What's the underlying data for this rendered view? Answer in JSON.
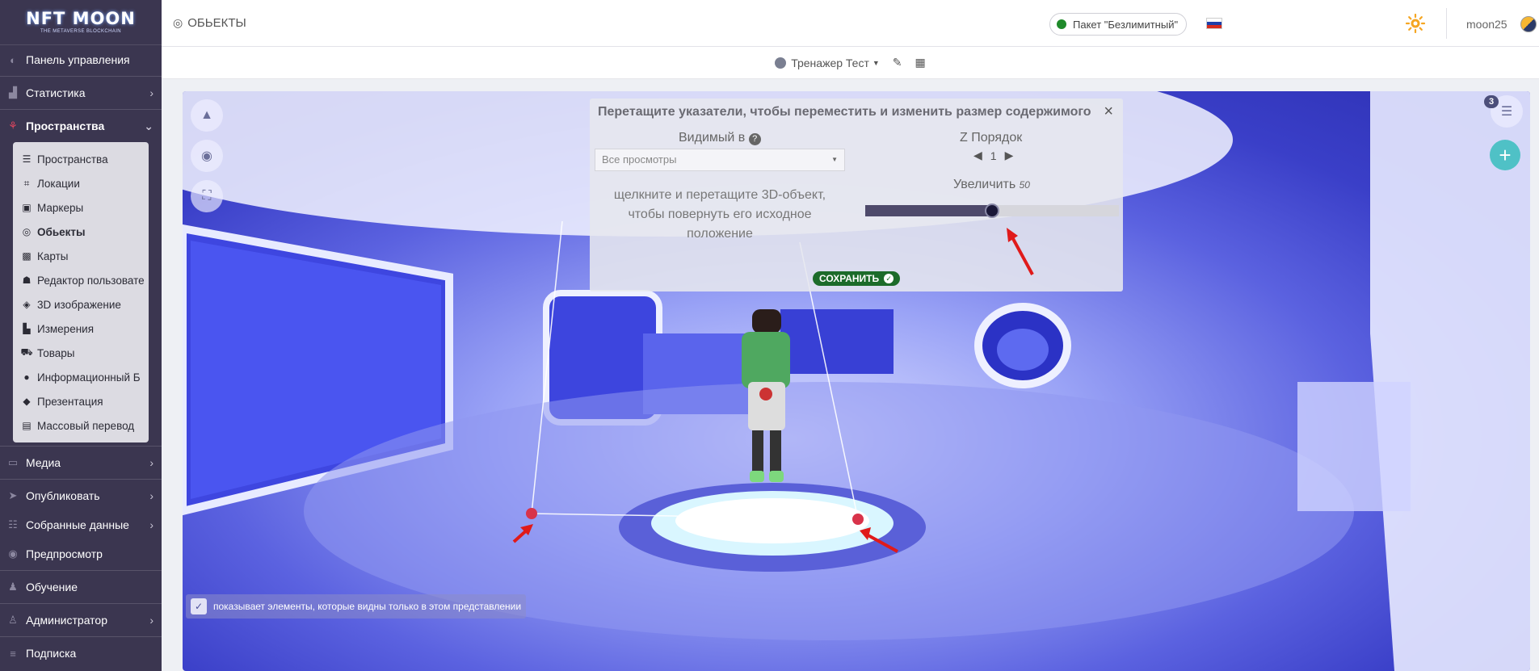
{
  "brand": {
    "logo_main": "NFT MOON",
    "logo_sub": "THE METAVERSE BLOCKCHAIN"
  },
  "sidebar": {
    "items": [
      {
        "label": "Панель управления",
        "icon": "palette-icon"
      },
      {
        "label": "Статистика",
        "icon": "chart-area-icon"
      },
      {
        "label": "Пространства",
        "icon": "network-icon"
      }
    ],
    "submenu": [
      {
        "label": "Пространства",
        "icon": "list-icon"
      },
      {
        "label": "Локации",
        "icon": "vector-square-icon"
      },
      {
        "label": "Маркеры",
        "icon": "image-icon"
      },
      {
        "label": "Обьекты",
        "icon": "bullseye-icon"
      },
      {
        "label": "Карты",
        "icon": "map-icon"
      },
      {
        "label": "Редактор пользовате",
        "icon": "user-edit-icon"
      },
      {
        "label": "3D изображение",
        "icon": "cube-icon"
      },
      {
        "label": "Измерения",
        "icon": "ruler-icon"
      },
      {
        "label": "Товары",
        "icon": "cart-icon"
      },
      {
        "label": "Информационный Б",
        "icon": "info-circle-icon"
      },
      {
        "label": "Презентация",
        "icon": "directions-icon"
      },
      {
        "label": "Массовый перевод",
        "icon": "language-card-icon"
      }
    ],
    "bottom_items": [
      {
        "label": "Медиа",
        "icon": "desktop-icon"
      },
      {
        "label": "Опубликовать",
        "icon": "paper-plane-icon"
      },
      {
        "label": "Собранные данные",
        "icon": "database-icon"
      },
      {
        "label": "Предпросмотр",
        "icon": "eye-icon"
      },
      {
        "label": "Обучение",
        "icon": "teacher-icon"
      },
      {
        "label": "Администратор",
        "icon": "user-icon"
      },
      {
        "label": "Подписка",
        "icon": "layers-icon"
      }
    ]
  },
  "topbar": {
    "title": "ОБЬЕКТЫ",
    "package": "Пакет \"Безлимитный\"",
    "package_status_color": "#1f8a2a",
    "username": "moon25"
  },
  "subbar": {
    "space_name": "Тренажер Тест"
  },
  "dialog": {
    "title": "Перетащите указатели, чтобы переместить и изменить размер содержимого",
    "visible_in_label": "Видимый в",
    "visible_in_value": "Все просмотры",
    "z_order_label": "Z Порядок",
    "z_order_value": "1",
    "rotate_hint": "щелкните и перетащите 3D-объект, чтобы повернуть его исходное положение",
    "zoom_label": "Увеличить",
    "zoom_value": "50",
    "zoom_level": 0.5,
    "save_label": "СОХРАНИТЬ"
  },
  "viewer": {
    "info_text": "показывает элементы, которые видны только в этом представлении",
    "items_count": "3"
  },
  "colors": {
    "sidebar_bg": "#3b3650",
    "save_green": "#1c6b2a",
    "accent_teal": "#4fc1c6",
    "active_icon": "#e0465f"
  }
}
